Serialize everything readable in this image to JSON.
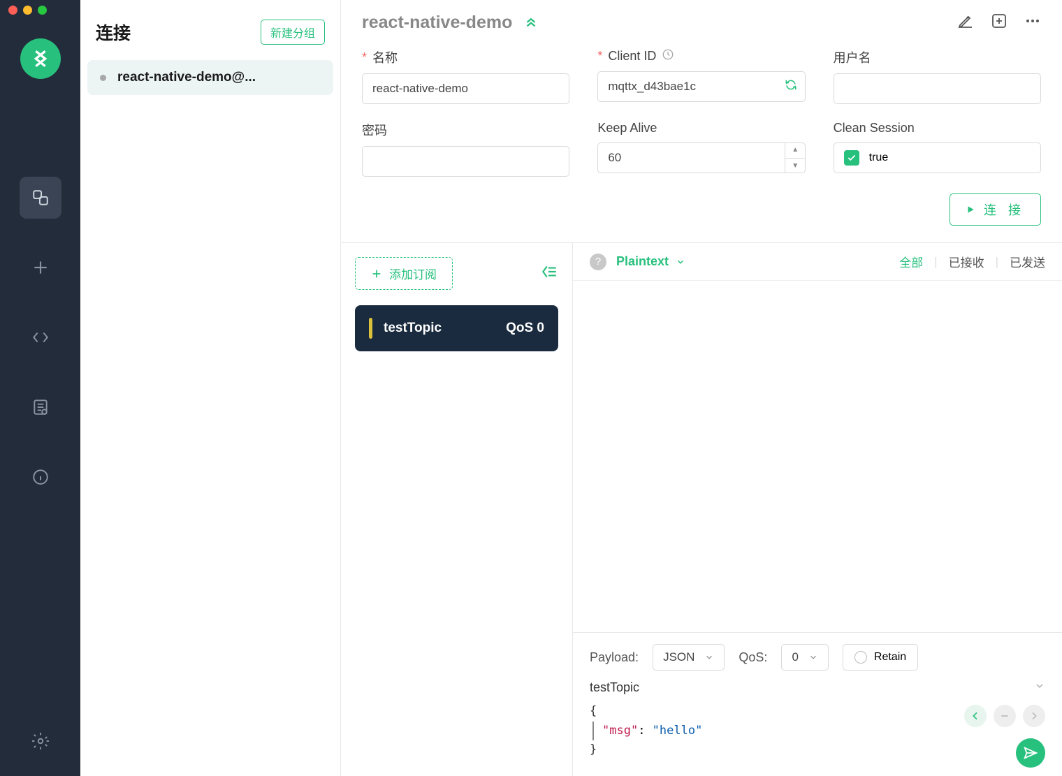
{
  "titlebar": {},
  "nav": {},
  "sidebar": {
    "title": "连接",
    "new_group_btn": "新建分组",
    "items": [
      {
        "name": "react-native-demo@..."
      }
    ]
  },
  "header": {
    "title": "react-native-demo"
  },
  "config": {
    "name": {
      "label": "名称",
      "value": "react-native-demo"
    },
    "client_id": {
      "label": "Client ID",
      "value": "mqttx_d43bae1c"
    },
    "username": {
      "label": "用户名",
      "value": ""
    },
    "password": {
      "label": "密码",
      "value": ""
    },
    "keep_alive": {
      "label": "Keep Alive",
      "value": "60"
    },
    "clean_session": {
      "label": "Clean Session",
      "value": "true"
    },
    "connect_btn": "连 接"
  },
  "subscriptions": {
    "add_btn": "添加订阅",
    "items": [
      {
        "topic": "testTopic",
        "qos": "QoS 0"
      }
    ]
  },
  "messages": {
    "format": "Plaintext",
    "filters": {
      "all": "全部",
      "received": "已接收",
      "sent": "已发送"
    }
  },
  "publish": {
    "payload_label": "Payload:",
    "payload_type": "JSON",
    "qos_label": "QoS:",
    "qos_value": "0",
    "retain_label": "Retain",
    "topic": "testTopic",
    "json": {
      "open": "{",
      "key": "\"msg\"",
      "colon": ": ",
      "val": "\"hello\"",
      "close": "}"
    }
  }
}
